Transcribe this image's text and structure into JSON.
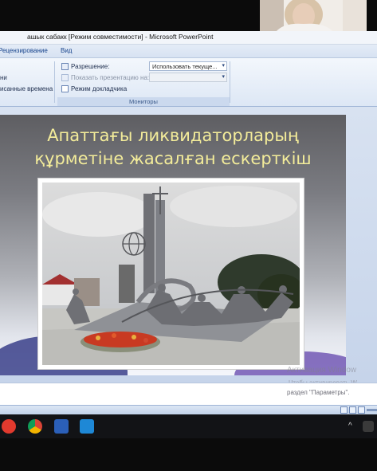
{
  "window": {
    "title": "ашык сабакк [Режим совместимости] - Microsoft PowerPoint"
  },
  "menu": {
    "tabs": [
      "Рецензирование",
      "Вид"
    ]
  },
  "ribbon": {
    "left_items": [
      "ни",
      "исанные времена"
    ],
    "resolution_label": "Разрешение:",
    "resolution_value": "Использовать текуще...",
    "show_on_label": "Показать презентацию на:",
    "presenter_view_label": "Режим докладчика",
    "group_label": "Мониторы"
  },
  "slide": {
    "title_line1": "Апаттағы ликвидаторларың",
    "title_line2": "құрметіне жасалған ескерткіш"
  },
  "activation": {
    "line1": "Активация Window",
    "line2": "Чтобы активировать W",
    "line3": "раздел \"Параметры\"."
  },
  "taskbar": {
    "tray_chevron": "^",
    "icons": [
      "yandex-browser",
      "chrome",
      "explorer-doc",
      "video-app"
    ]
  },
  "colors": {
    "title_text": "#f3ec9a",
    "ribbon_text": "#15428b",
    "taskbar": "#121316"
  }
}
